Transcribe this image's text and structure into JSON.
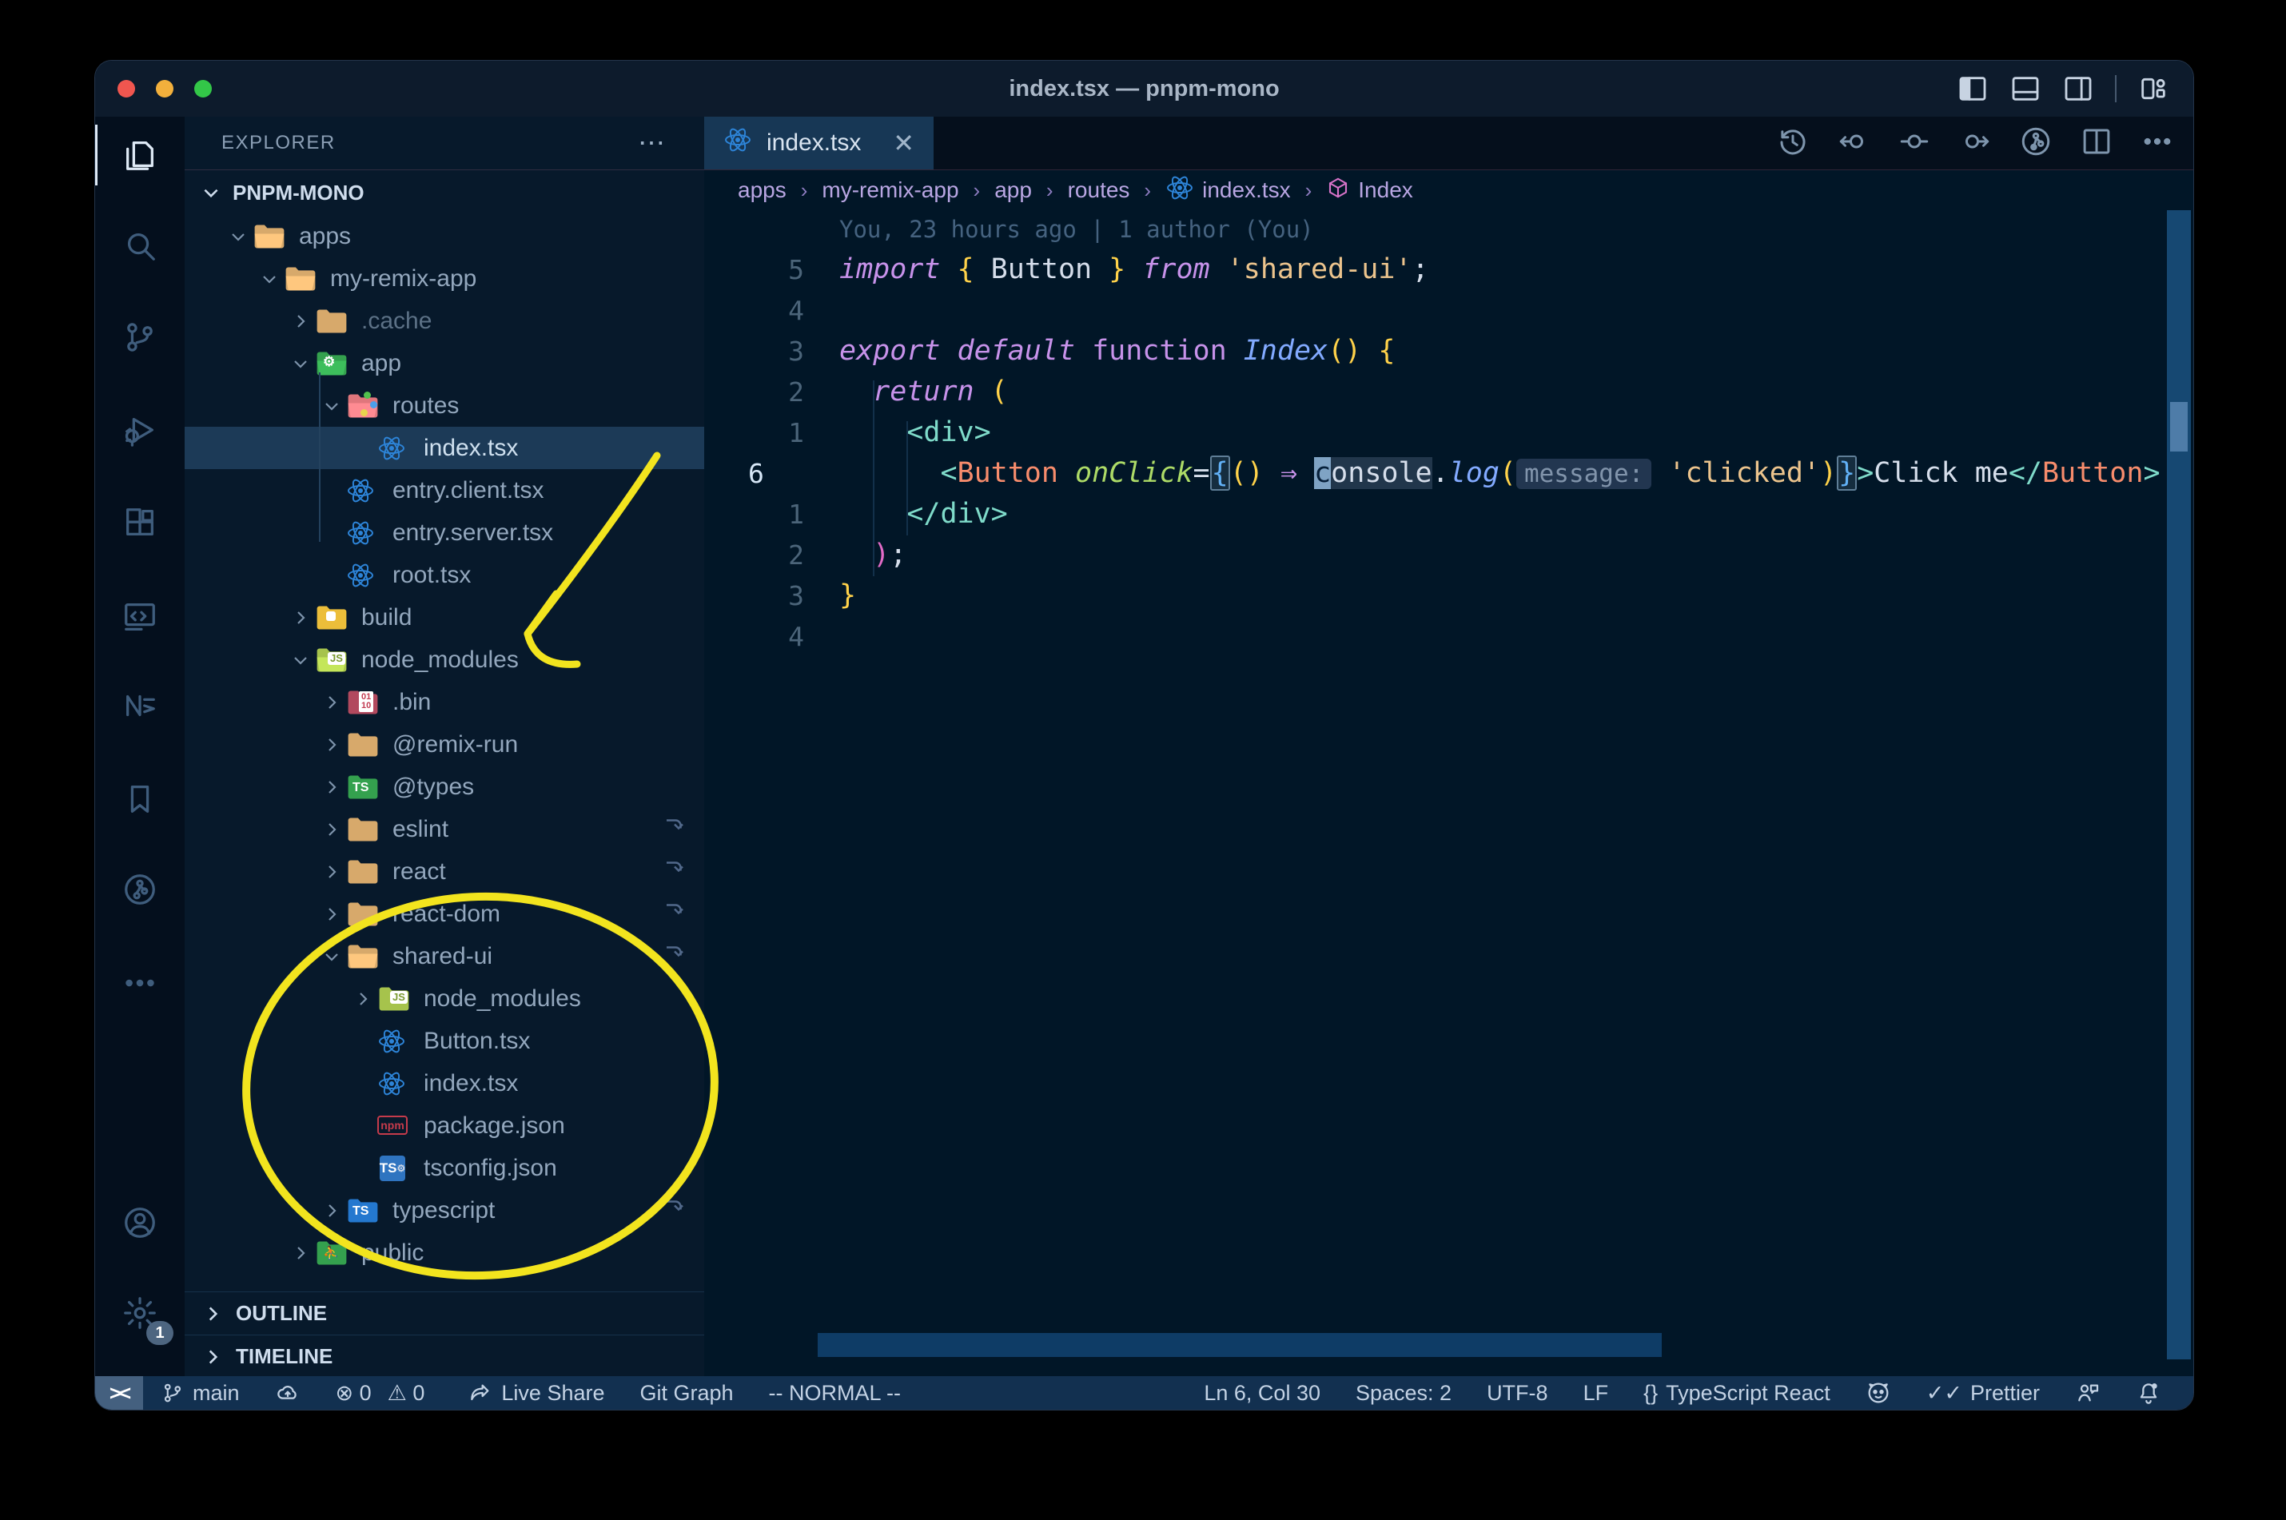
{
  "window": {
    "title": "index.tsx — pnpm-mono"
  },
  "titlebar_controls": [
    {
      "name": "layout-sidebar-left-icon"
    },
    {
      "name": "layout-panel-icon"
    },
    {
      "name": "layout-sidebar-right-icon"
    },
    {
      "name": "separator"
    },
    {
      "name": "layout-customize-icon"
    }
  ],
  "activity_bar": {
    "items": [
      {
        "name": "explorer",
        "active": true
      },
      {
        "name": "search"
      },
      {
        "name": "source-control"
      },
      {
        "name": "run-debug"
      },
      {
        "name": "extensions"
      },
      {
        "name": "remote-explorer"
      },
      {
        "name": "nx-console"
      },
      {
        "name": "bookmarks"
      },
      {
        "name": "gitlens"
      },
      {
        "name": "more"
      }
    ],
    "bottom_items": [
      {
        "name": "accounts"
      },
      {
        "name": "settings",
        "badge": "1"
      }
    ],
    "settings_badge": "1"
  },
  "explorer": {
    "header": "EXPLORER",
    "more_label": "⋯",
    "section": "PNPM-MONO",
    "tree": [
      {
        "label": "apps",
        "kind": "folder",
        "open": true,
        "color": "tan",
        "level": 1
      },
      {
        "label": "my-remix-app",
        "kind": "folder",
        "open": true,
        "color": "tan",
        "level": 2
      },
      {
        "label": ".cache",
        "kind": "folder",
        "open": false,
        "color": "tan",
        "level": 3,
        "dim": true
      },
      {
        "label": "app",
        "kind": "folder",
        "open": true,
        "color": "green",
        "badge": "gear",
        "level": 3
      },
      {
        "label": "routes",
        "kind": "folder",
        "open": true,
        "color": "rose",
        "badge": "routes",
        "level": 4
      },
      {
        "label": "index.tsx",
        "kind": "file",
        "icon": "react",
        "level": 5,
        "selected": true
      },
      {
        "label": "entry.client.tsx",
        "kind": "file",
        "icon": "react",
        "level": 4
      },
      {
        "label": "entry.server.tsx",
        "kind": "file",
        "icon": "react",
        "level": 4
      },
      {
        "label": "root.tsx",
        "kind": "file",
        "icon": "react",
        "level": 4
      },
      {
        "label": "build",
        "kind": "folder",
        "open": false,
        "color": "amber",
        "badge": "build",
        "level": 3
      },
      {
        "label": "node_modules",
        "kind": "folder",
        "open": true,
        "color": "lime",
        "badge": "js",
        "level": 3
      },
      {
        "label": ".bin",
        "kind": "folder",
        "open": false,
        "color": "maroon",
        "badge": "bin",
        "level": 4
      },
      {
        "label": "@remix-run",
        "kind": "folder",
        "open": false,
        "color": "tan",
        "level": 4
      },
      {
        "label": "@types",
        "kind": "folder",
        "open": false,
        "color": "green",
        "badge": "ts",
        "level": 4
      },
      {
        "label": "eslint",
        "kind": "folder",
        "open": false,
        "color": "tan",
        "level": 4,
        "symlink": true
      },
      {
        "label": "react",
        "kind": "folder",
        "open": false,
        "color": "tan",
        "level": 4,
        "symlink": true
      },
      {
        "label": "react-dom",
        "kind": "folder",
        "open": false,
        "color": "tan",
        "level": 4,
        "symlink": true
      },
      {
        "label": "shared-ui",
        "kind": "folder",
        "open": true,
        "color": "tan",
        "level": 4,
        "symlink": true
      },
      {
        "label": "node_modules",
        "kind": "folder",
        "open": false,
        "color": "lime",
        "badge": "js",
        "level": 5
      },
      {
        "label": "Button.tsx",
        "kind": "file",
        "icon": "react",
        "level": 5
      },
      {
        "label": "index.tsx",
        "kind": "file",
        "icon": "react",
        "level": 5
      },
      {
        "label": "package.json",
        "kind": "file",
        "icon": "npm",
        "level": 5
      },
      {
        "label": "tsconfig.json",
        "kind": "file",
        "icon": "ts",
        "level": 5
      },
      {
        "label": "typescript",
        "kind": "folder",
        "open": false,
        "color": "blue",
        "badge": "ts",
        "level": 4,
        "symlink": true
      },
      {
        "label": "public",
        "kind": "folder",
        "open": false,
        "color": "green",
        "badge": "people",
        "level": 3
      }
    ],
    "outline_label": "OUTLINE",
    "timeline_label": "TIMELINE"
  },
  "editor_group": {
    "tab": {
      "label": "index.tsx",
      "icon": "react",
      "close": "✕"
    },
    "toolbar": [
      {
        "name": "timeline-history-icon"
      },
      {
        "name": "navigate-back-icon"
      },
      {
        "name": "navigate-current-icon"
      },
      {
        "name": "navigate-forward-icon"
      },
      {
        "name": "gitlens-graph-icon"
      },
      {
        "name": "split-editor-icon"
      },
      {
        "name": "more-actions-icon"
      }
    ],
    "breadcrumbs": [
      {
        "label": "apps"
      },
      {
        "label": "my-remix-app"
      },
      {
        "label": "app"
      },
      {
        "label": "routes"
      },
      {
        "label": "index.tsx",
        "icon": "react"
      },
      {
        "label": "Index",
        "icon": "symbol-class"
      }
    ]
  },
  "editor": {
    "blame": "You, 23 hours ago | 1 author (You)",
    "lines": [
      {
        "gut": "5",
        "tokens": [
          {
            "t": "import ",
            "c": "kw"
          },
          {
            "t": "{ ",
            "c": "gold"
          },
          {
            "t": "Button",
            "c": "txt"
          },
          {
            "t": " } ",
            "c": "gold"
          },
          {
            "t": "from ",
            "c": "kw"
          },
          {
            "t": "'shared-ui'",
            "c": "str"
          },
          {
            "t": ";",
            "c": "txt"
          }
        ]
      },
      {
        "gut": "4",
        "tokens": []
      },
      {
        "gut": "3",
        "tokens": [
          {
            "t": "export default ",
            "c": "kw"
          },
          {
            "t": "function ",
            "c": "kwu"
          },
          {
            "t": "Index",
            "c": "fn"
          },
          {
            "t": "()",
            "c": "gold"
          },
          {
            "t": " ",
            "c": "txt"
          },
          {
            "t": "{",
            "c": "gold"
          }
        ]
      },
      {
        "gut": "2",
        "tokens": [
          {
            "t": "  ",
            "c": "txt"
          },
          {
            "t": "return ",
            "c": "kw"
          },
          {
            "t": "(",
            "c": "gold"
          }
        ]
      },
      {
        "gut": "1",
        "tokens": [
          {
            "t": "    ",
            "c": "txt"
          },
          {
            "t": "<div>",
            "c": "tag"
          }
        ]
      },
      {
        "gut": "6",
        "current": true,
        "tokens": [
          {
            "t": "      ",
            "c": "txt"
          },
          {
            "t": "<",
            "c": "tag"
          },
          {
            "t": "Button",
            "c": "comp"
          },
          {
            "t": " ",
            "c": "txt"
          },
          {
            "t": "onClick",
            "c": "attr"
          },
          {
            "t": "=",
            "c": "txt"
          },
          {
            "t": "{",
            "c": "match"
          },
          {
            "t": "()",
            "c": "gold"
          },
          {
            "t": " ",
            "c": "txt"
          },
          {
            "t": "⇒",
            "c": "arrow"
          },
          {
            "t": " ",
            "c": "txt"
          },
          {
            "t": "c",
            "c": "cursor"
          },
          {
            "t": "onsole",
            "c": "hl"
          },
          {
            "t": ".",
            "c": "txt"
          },
          {
            "t": "log",
            "c": "fn"
          },
          {
            "t": "(",
            "c": "gold"
          },
          {
            "t": "message:",
            "c": "inlay"
          },
          {
            "t": " ",
            "c": "txt"
          },
          {
            "t": "'clicked'",
            "c": "str"
          },
          {
            "t": ")",
            "c": "gold"
          },
          {
            "t": "}",
            "c": "match"
          },
          {
            "t": ">",
            "c": "tag"
          },
          {
            "t": "Click me",
            "c": "txt"
          },
          {
            "t": "</",
            "c": "tag"
          },
          {
            "t": "Button",
            "c": "comp"
          },
          {
            "t": ">",
            "c": "tag"
          }
        ]
      },
      {
        "gut": "1",
        "tokens": [
          {
            "t": "    ",
            "c": "txt"
          },
          {
            "t": "</div>",
            "c": "tag"
          }
        ]
      },
      {
        "gut": "2",
        "tokens": [
          {
            "t": "  ",
            "c": "txt"
          },
          {
            "t": ")",
            "c": "pink"
          },
          {
            "t": ";",
            "c": "txt"
          }
        ]
      },
      {
        "gut": "3",
        "tokens": [
          {
            "t": "}",
            "c": "gold"
          }
        ]
      },
      {
        "gut": "4",
        "tokens": []
      }
    ]
  },
  "status_bar": {
    "left": [
      {
        "name": "remote-indicator",
        "chip": true,
        "text": "><"
      },
      {
        "name": "git-branch",
        "icon": "branch",
        "label": "main"
      },
      {
        "name": "sync-changes",
        "icon": "cloud"
      },
      {
        "name": "problems",
        "parts": [
          {
            "glyph": "⊗",
            "text": "0"
          },
          {
            "glyph": "⚠",
            "text": "0"
          }
        ]
      },
      {
        "name": "live-share",
        "icon": "share",
        "label": "Live Share"
      },
      {
        "name": "git-graph",
        "label": "Git Graph"
      },
      {
        "name": "vim-mode",
        "label": "-- NORMAL --"
      }
    ],
    "right": [
      {
        "name": "cursor-position",
        "label": "Ln 6, Col 30"
      },
      {
        "name": "indentation",
        "label": "Spaces: 2"
      },
      {
        "name": "encoding",
        "label": "UTF-8"
      },
      {
        "name": "eol",
        "label": "LF"
      },
      {
        "name": "language-mode",
        "glyph": "{}",
        "label": "TypeScript React"
      },
      {
        "name": "github-octoface",
        "icon": "octoface"
      },
      {
        "name": "prettier",
        "glyph": "✓✓",
        "label": "Prettier"
      },
      {
        "name": "feedback",
        "icon": "feedback"
      },
      {
        "name": "notifications",
        "icon": "bell"
      }
    ]
  },
  "annotations": {
    "color": "#f2e41e",
    "shapes": [
      "hand-drawn-arrow-to-node-modules",
      "hand-drawn-ellipse-around-shared-ui"
    ]
  }
}
